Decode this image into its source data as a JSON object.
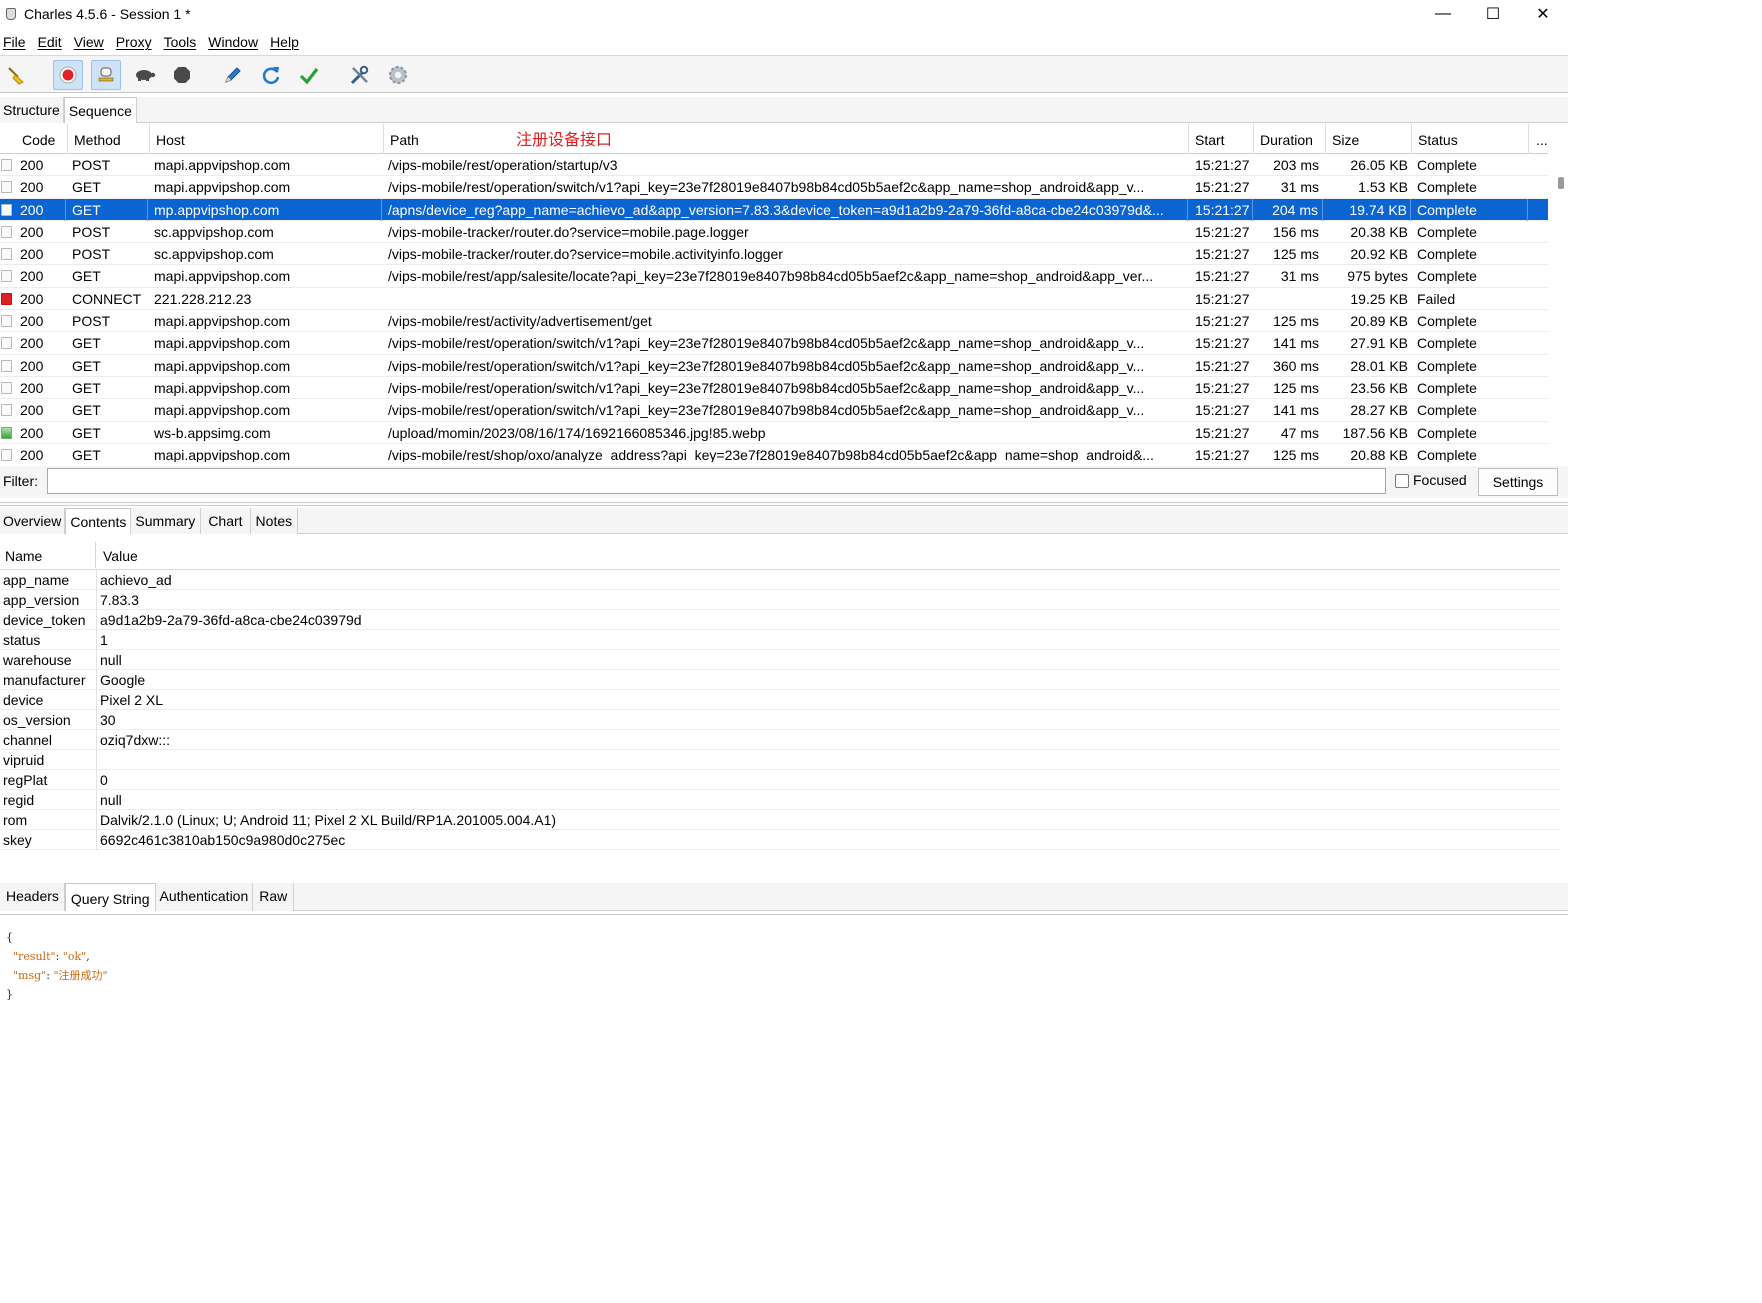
{
  "window": {
    "title": "Charles 4.5.6 - Session 1 *",
    "controls": {
      "minimize": "—",
      "maximize": "☐",
      "close": "✕"
    }
  },
  "menu": [
    "File",
    "Edit",
    "View",
    "Proxy",
    "Tools",
    "Window",
    "Help"
  ],
  "toolbar": {
    "icons": [
      "broom-icon",
      "record-icon",
      "throttle-icon",
      "turtle-icon",
      "stop-icon",
      "pen-icon",
      "refresh-icon",
      "check-icon",
      "tools-icon",
      "settings-gear-icon"
    ]
  },
  "view_tabs": [
    "Structure",
    "Sequence"
  ],
  "annotation": "注册设备接口",
  "sessions": {
    "columns": [
      "Code",
      "Method",
      "Host",
      "Path",
      "Start",
      "Duration",
      "Size",
      "Status",
      "..."
    ],
    "rows": [
      {
        "icon": "request",
        "code": "200",
        "method": "POST",
        "host": "mapi.appvipshop.com",
        "path": "/vips-mobile/rest/operation/startup/v3",
        "start": "15:21:27",
        "duration": "203 ms",
        "size": "26.05 KB",
        "status": "Complete"
      },
      {
        "icon": "request",
        "code": "200",
        "method": "GET",
        "host": "mapi.appvipshop.com",
        "path": "/vips-mobile/rest/operation/switch/v1?api_key=23e7f28019e8407b98b84cd05b5aef2c&app_name=shop_android&app_v...",
        "start": "15:21:27",
        "duration": "31 ms",
        "size": "1.53 KB",
        "status": "Complete"
      },
      {
        "icon": "request",
        "code": "200",
        "method": "GET",
        "host": "mp.appvipshop.com",
        "path": "/apns/device_reg?app_name=achievo_ad&app_version=7.83.3&device_token=a9d1a2b9-2a79-36fd-a8ca-cbe24c03979d&...",
        "start": "15:21:27",
        "duration": "204 ms",
        "size": "19.74 KB",
        "status": "Complete",
        "selected": true
      },
      {
        "icon": "request",
        "code": "200",
        "method": "POST",
        "host": "sc.appvipshop.com",
        "path": "/vips-mobile-tracker/router.do?service=mobile.page.logger",
        "start": "15:21:27",
        "duration": "156 ms",
        "size": "20.38 KB",
        "status": "Complete"
      },
      {
        "icon": "request",
        "code": "200",
        "method": "POST",
        "host": "sc.appvipshop.com",
        "path": "/vips-mobile-tracker/router.do?service=mobile.activityinfo.logger",
        "start": "15:21:27",
        "duration": "125 ms",
        "size": "20.92 KB",
        "status": "Complete"
      },
      {
        "icon": "request",
        "code": "200",
        "method": "GET",
        "host": "mapi.appvipshop.com",
        "path": "/vips-mobile/rest/app/salesite/locate?api_key=23e7f28019e8407b98b84cd05b5aef2c&app_name=shop_android&app_ver...",
        "start": "15:21:27",
        "duration": "31 ms",
        "size": "975 bytes",
        "status": "Complete"
      },
      {
        "icon": "error",
        "code": "200",
        "method": "CONNECT",
        "host": "221.228.212.23",
        "path": "",
        "start": "15:21:27",
        "duration": "",
        "size": "19.25 KB",
        "status": "Failed"
      },
      {
        "icon": "request",
        "code": "200",
        "method": "POST",
        "host": "mapi.appvipshop.com",
        "path": "/vips-mobile/rest/activity/advertisement/get",
        "start": "15:21:27",
        "duration": "125 ms",
        "size": "20.89 KB",
        "status": "Complete"
      },
      {
        "icon": "request",
        "code": "200",
        "method": "GET",
        "host": "mapi.appvipshop.com",
        "path": "/vips-mobile/rest/operation/switch/v1?api_key=23e7f28019e8407b98b84cd05b5aef2c&app_name=shop_android&app_v...",
        "start": "15:21:27",
        "duration": "141 ms",
        "size": "27.91 KB",
        "status": "Complete"
      },
      {
        "icon": "request",
        "code": "200",
        "method": "GET",
        "host": "mapi.appvipshop.com",
        "path": "/vips-mobile/rest/operation/switch/v1?api_key=23e7f28019e8407b98b84cd05b5aef2c&app_name=shop_android&app_v...",
        "start": "15:21:27",
        "duration": "360 ms",
        "size": "28.01 KB",
        "status": "Complete"
      },
      {
        "icon": "request",
        "code": "200",
        "method": "GET",
        "host": "mapi.appvipshop.com",
        "path": "/vips-mobile/rest/operation/switch/v1?api_key=23e7f28019e8407b98b84cd05b5aef2c&app_name=shop_android&app_v...",
        "start": "15:21:27",
        "duration": "125 ms",
        "size": "23.56 KB",
        "status": "Complete"
      },
      {
        "icon": "request",
        "code": "200",
        "method": "GET",
        "host": "mapi.appvipshop.com",
        "path": "/vips-mobile/rest/operation/switch/v1?api_key=23e7f28019e8407b98b84cd05b5aef2c&app_name=shop_android&app_v...",
        "start": "15:21:27",
        "duration": "141 ms",
        "size": "28.27 KB",
        "status": "Complete"
      },
      {
        "icon": "image",
        "code": "200",
        "method": "GET",
        "host": "ws-b.appsimg.com",
        "path": "/upload/momin/2023/08/16/174/1692166085346.jpg!85.webp",
        "start": "15:21:27",
        "duration": "47 ms",
        "size": "187.56 KB",
        "status": "Complete"
      },
      {
        "icon": "request",
        "code": "200",
        "method": "GET",
        "host": "mapi.appvipshop.com",
        "path": "/vips-mobile/rest/shop/oxo/analyze_address?api_key=23e7f28019e8407b98b84cd05b5aef2c&app_name=shop_android&...",
        "start": "15:21:27",
        "duration": "125 ms",
        "size": "20.88 KB",
        "status": "Complete"
      }
    ]
  },
  "filter": {
    "label": "Filter:",
    "value": "",
    "focused_label": "Focused",
    "focused_checked": false,
    "settings_label": "Settings"
  },
  "detail_tabs": [
    "Overview",
    "Contents",
    "Summary",
    "Chart",
    "Notes"
  ],
  "detail_selected": "Contents",
  "params": {
    "headers": [
      "Name",
      "Value"
    ],
    "rows": [
      {
        "name": "app_name",
        "value": "achievo_ad"
      },
      {
        "name": "app_version",
        "value": "7.83.3"
      },
      {
        "name": "device_token",
        "value": "a9d1a2b9-2a79-36fd-a8ca-cbe24c03979d"
      },
      {
        "name": "status",
        "value": "1"
      },
      {
        "name": "warehouse",
        "value": "null"
      },
      {
        "name": "manufacturer",
        "value": "Google"
      },
      {
        "name": "device",
        "value": "Pixel 2 XL"
      },
      {
        "name": "os_version",
        "value": "30"
      },
      {
        "name": "channel",
        "value": "oziq7dxw:::"
      },
      {
        "name": "vipruid",
        "value": ""
      },
      {
        "name": "regPlat",
        "value": "0"
      },
      {
        "name": "regid",
        "value": "null"
      },
      {
        "name": "rom",
        "value": "Dalvik/2.1.0 (Linux; U; Android 11; Pixel 2 XL Build/RP1A.201005.004.A1)"
      },
      {
        "name": "skey",
        "value": "6692c461c3810ab150c9a980d0c275ec"
      }
    ]
  },
  "request_tabs": [
    "Headers",
    "Query String",
    "Authentication",
    "Raw"
  ],
  "request_selected": "Query String",
  "response_body": {
    "open": "{",
    "lines": [
      {
        "key": "\"result\"",
        "value": "\"ok\"",
        "trail": ","
      },
      {
        "key": "\"msg\"",
        "value": "\"注册成功\"",
        "trail": ""
      }
    ],
    "close": "}"
  },
  "colors": {
    "selection": "#0a64d2",
    "annotation": "#e02020",
    "json_value": "#c96a12"
  }
}
